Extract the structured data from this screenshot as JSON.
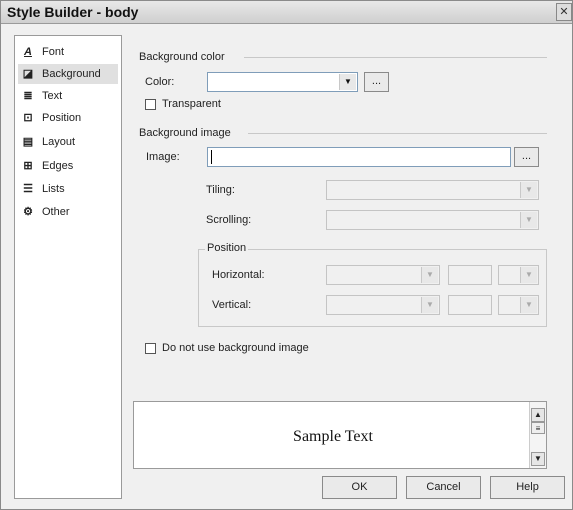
{
  "window": {
    "title": "Style Builder - body",
    "close_glyph": "✕"
  },
  "sidebar": {
    "items": [
      {
        "label": "Font",
        "icon": "font-icon",
        "glyph": "A"
      },
      {
        "label": "Background",
        "icon": "background-icon",
        "glyph": "◪"
      },
      {
        "label": "Text",
        "icon": "text-icon",
        "glyph": "≣"
      },
      {
        "label": "Position",
        "icon": "position-icon",
        "glyph": "⊡"
      },
      {
        "label": "Layout",
        "icon": "layout-icon",
        "glyph": "▤"
      },
      {
        "label": "Edges",
        "icon": "edges-icon",
        "glyph": "⊞"
      },
      {
        "label": "Lists",
        "icon": "lists-icon",
        "glyph": "☰"
      },
      {
        "label": "Other",
        "icon": "other-icon",
        "glyph": "⚙"
      }
    ],
    "selected": "Background"
  },
  "background_color": {
    "section_label": "Background color",
    "color_label": "Color:",
    "color_value": "",
    "browse_label": "...",
    "transparent_label": "Transparent",
    "transparent_checked": false
  },
  "background_image": {
    "section_label": "Background image",
    "image_label": "Image:",
    "image_value": "",
    "browse_label": "...",
    "tiling_label": "Tiling:",
    "scrolling_label": "Scrolling:",
    "position_label": "Position",
    "horizontal_label": "Horizontal:",
    "vertical_label": "Vertical:",
    "no_image_label": "Do not use background image",
    "no_image_checked": false
  },
  "preview": {
    "sample_text": "Sample Text"
  },
  "buttons": {
    "ok": "OK",
    "cancel": "Cancel",
    "help": "Help"
  },
  "colors": {
    "window_bg": "#f0f0f0",
    "border": "#7f9db9"
  }
}
